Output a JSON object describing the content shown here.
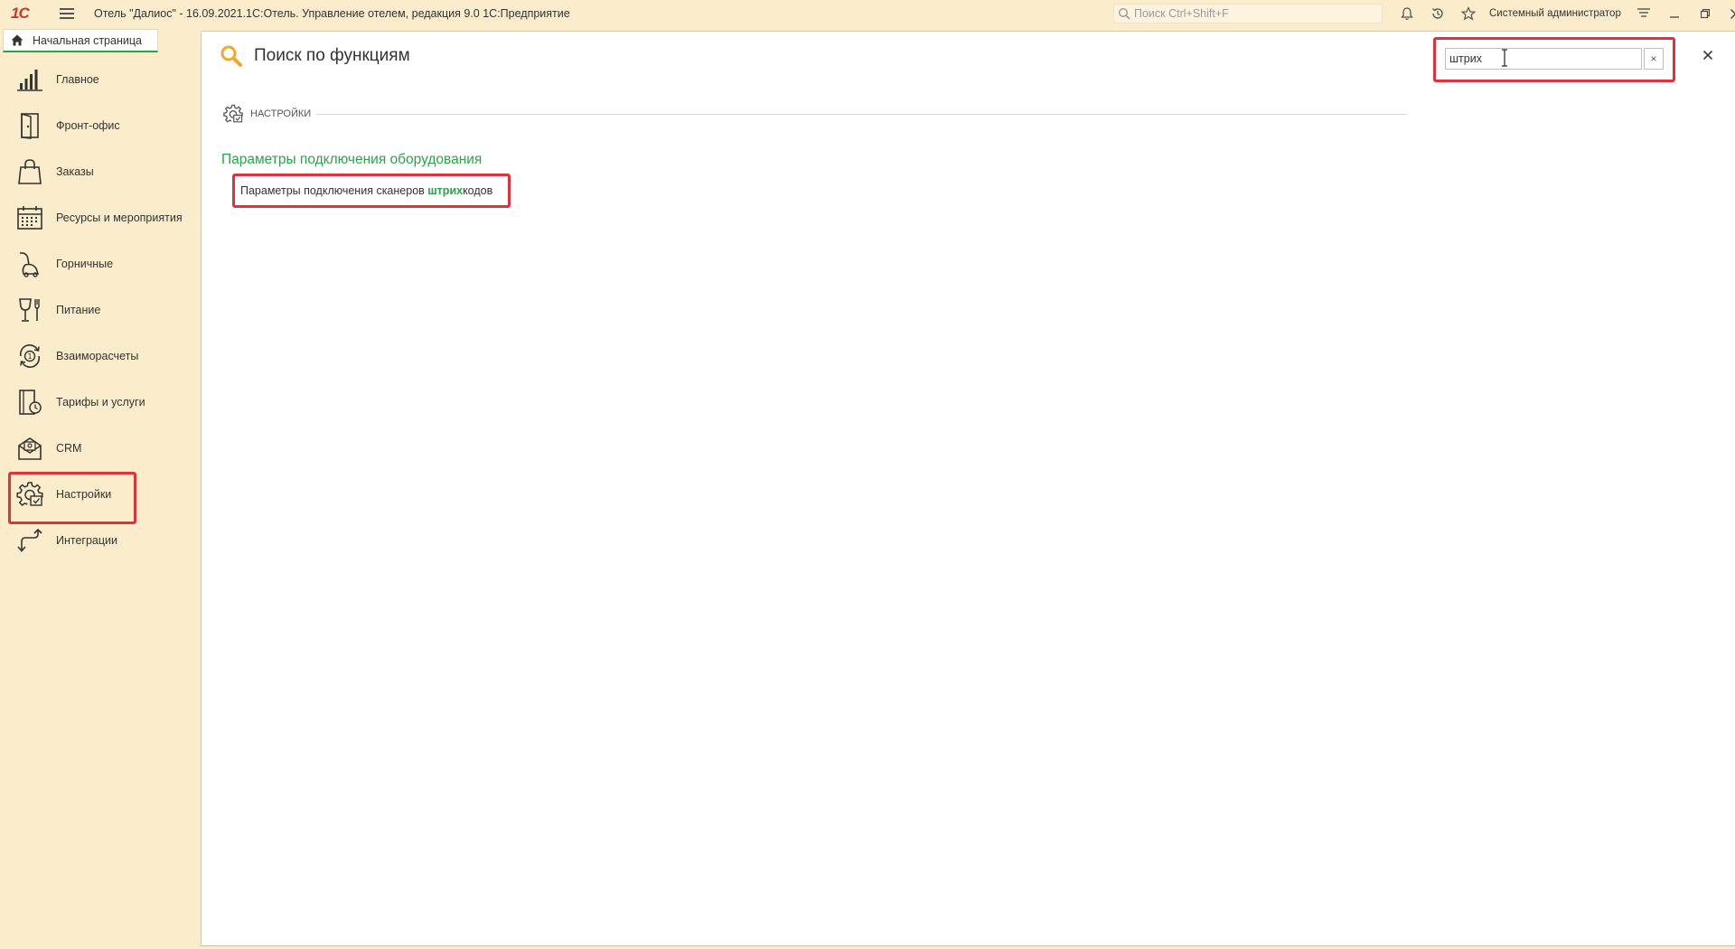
{
  "app": {
    "title": "Отель \"Далиос\" - 16.09.2021.1С:Отель. Управление отелем, редакция 9.0 1С:Предприятие",
    "logo_text": "1С",
    "global_search_placeholder": "Поиск Ctrl+Shift+F",
    "user": "Системный администратор",
    "accent_color": "#2aa34a",
    "highlight_color": "#e0323c"
  },
  "home_tab": {
    "label": "Начальная страница"
  },
  "sidebar": {
    "items": [
      {
        "label": "Главное",
        "icon": "chart-bars-icon"
      },
      {
        "label": "Фронт-офис",
        "icon": "door-icon"
      },
      {
        "label": "Заказы",
        "icon": "shopping-bag-icon"
      },
      {
        "label": "Ресурсы и мероприятия",
        "icon": "calendar-icon"
      },
      {
        "label": "Горничные",
        "icon": "vacuum-cleaner-icon"
      },
      {
        "label": "Питание",
        "icon": "glass-fork-icon"
      },
      {
        "label": "Взаиморасчеты",
        "icon": "coin-cycle-icon"
      },
      {
        "label": "Тарифы и услуги",
        "icon": "price-book-icon"
      },
      {
        "label": "CRM",
        "icon": "mail-contact-icon"
      },
      {
        "label": "Настройки",
        "icon": "gear-settings-icon",
        "highlighted": true
      },
      {
        "label": "Интеграции",
        "icon": "integration-arrows-icon"
      }
    ]
  },
  "main": {
    "title": "Поиск по функциям",
    "search_value": "штрих",
    "section_label": "НАСТРОЙКИ",
    "group_title": "Параметры подключения оборудования",
    "result": {
      "prefix": "Параметры подключения сканеров ",
      "match": "штрих",
      "suffix": "кодов"
    }
  }
}
